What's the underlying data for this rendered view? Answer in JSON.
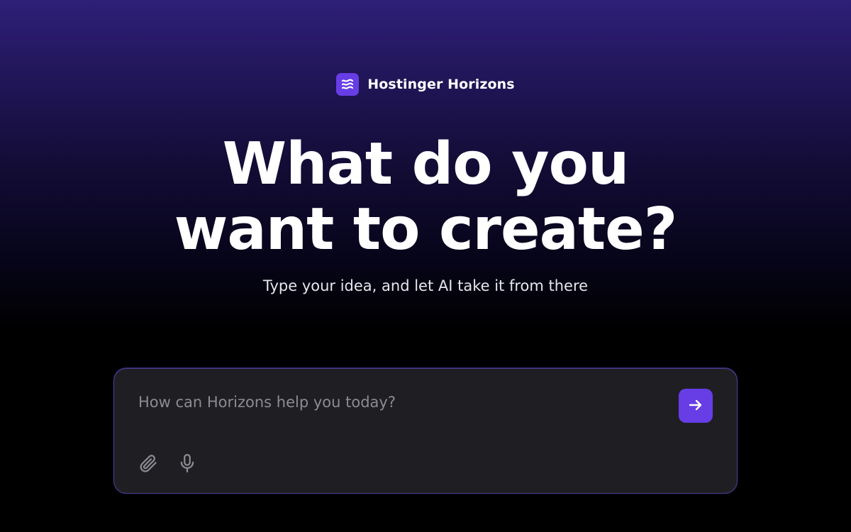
{
  "brand": {
    "name": "Hostinger Horizons",
    "logo_icon": "horizons-waves-icon"
  },
  "hero": {
    "headline_line1": "What do you",
    "headline_line2": "want to create?",
    "subtitle": "Type your idea, and let AI take it from there"
  },
  "prompt": {
    "placeholder": "How can Horizons help you today?",
    "value": "",
    "send_icon": "arrow-right-icon",
    "attach_icon": "paperclip-icon",
    "mic_icon": "microphone-icon"
  },
  "colors": {
    "accent": "#673de6",
    "background": "#000000",
    "glow": "#2e1f78",
    "input_bg": "#1f1f23"
  }
}
